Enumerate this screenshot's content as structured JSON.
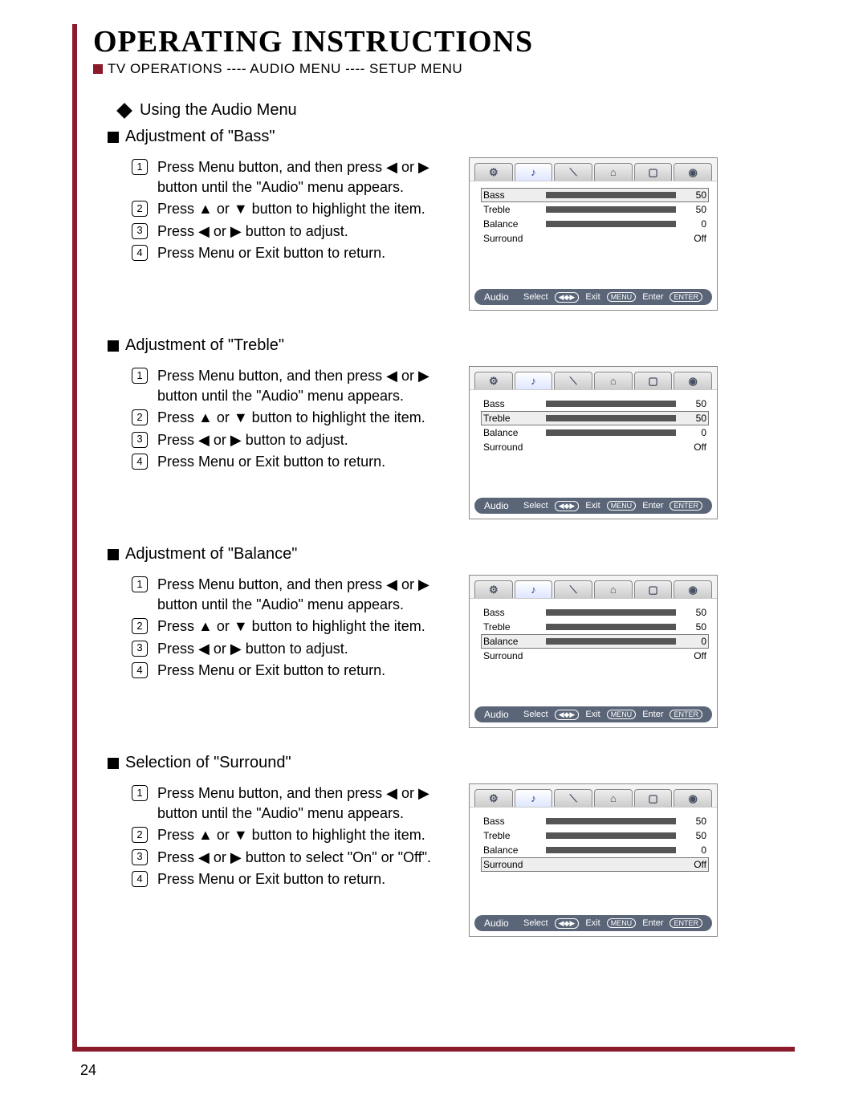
{
  "page": {
    "title": "OPERATING INSTRUCTIONS",
    "breadcrumb": "TV OPERATIONS ---- AUDIO MENU ---- SETUP MENU",
    "number": "24"
  },
  "lead_heading": "Using the Audio Menu",
  "sections": [
    {
      "heading": "Adjustment of \"Bass\"",
      "steps_variant": "adjust",
      "highlight": "Bass"
    },
    {
      "heading": "Adjustment of \"Treble\"",
      "steps_variant": "adjust",
      "highlight": "Treble"
    },
    {
      "heading": "Adjustment of \"Balance\"",
      "steps_variant": "adjust",
      "highlight": "Balance"
    },
    {
      "heading": "Selection of \"Surround\"",
      "steps_variant": "select",
      "highlight": "Surround"
    }
  ],
  "steps": {
    "adjust": [
      "Press <b>Menu</b> button, and then press ◀ or ▶ button until the \"Audio\" menu appears.",
      "Press ▲ or ▼ button to highlight the item.",
      "Press ◀ or ▶ button to adjust.",
      "Press <b>Menu</b> or <b>Exit</b> button to return."
    ],
    "select": [
      "Press <b>Menu</b> button, and then press ◀ or ▶ button until the \"Audio\" menu appears.",
      "Press ▲ or ▼ button to highlight the item.",
      "Press  ◀ or ▶ button to select \"On\" or \"Off\".",
      "Press <b>Menu</b> or <b>Exit</b> button to return."
    ]
  },
  "osd": {
    "tabs": [
      "⚙",
      "♪",
      "⟍",
      "⌂",
      "▢",
      "◉"
    ],
    "active_tab": 1,
    "rows": [
      {
        "label": "Bass",
        "bar": true,
        "value": "50"
      },
      {
        "label": "Treble",
        "bar": true,
        "value": "50"
      },
      {
        "label": "Balance",
        "bar": true,
        "value": "0"
      },
      {
        "label": "Surround",
        "bar": false,
        "value": "Off"
      }
    ],
    "status": {
      "menu": "Audio",
      "select_label": "Select",
      "select_icon": "◀◆▶",
      "exit_label": "Exit",
      "exit_btn": "MENU",
      "enter_label": "Enter",
      "enter_btn": "ENTER"
    }
  }
}
